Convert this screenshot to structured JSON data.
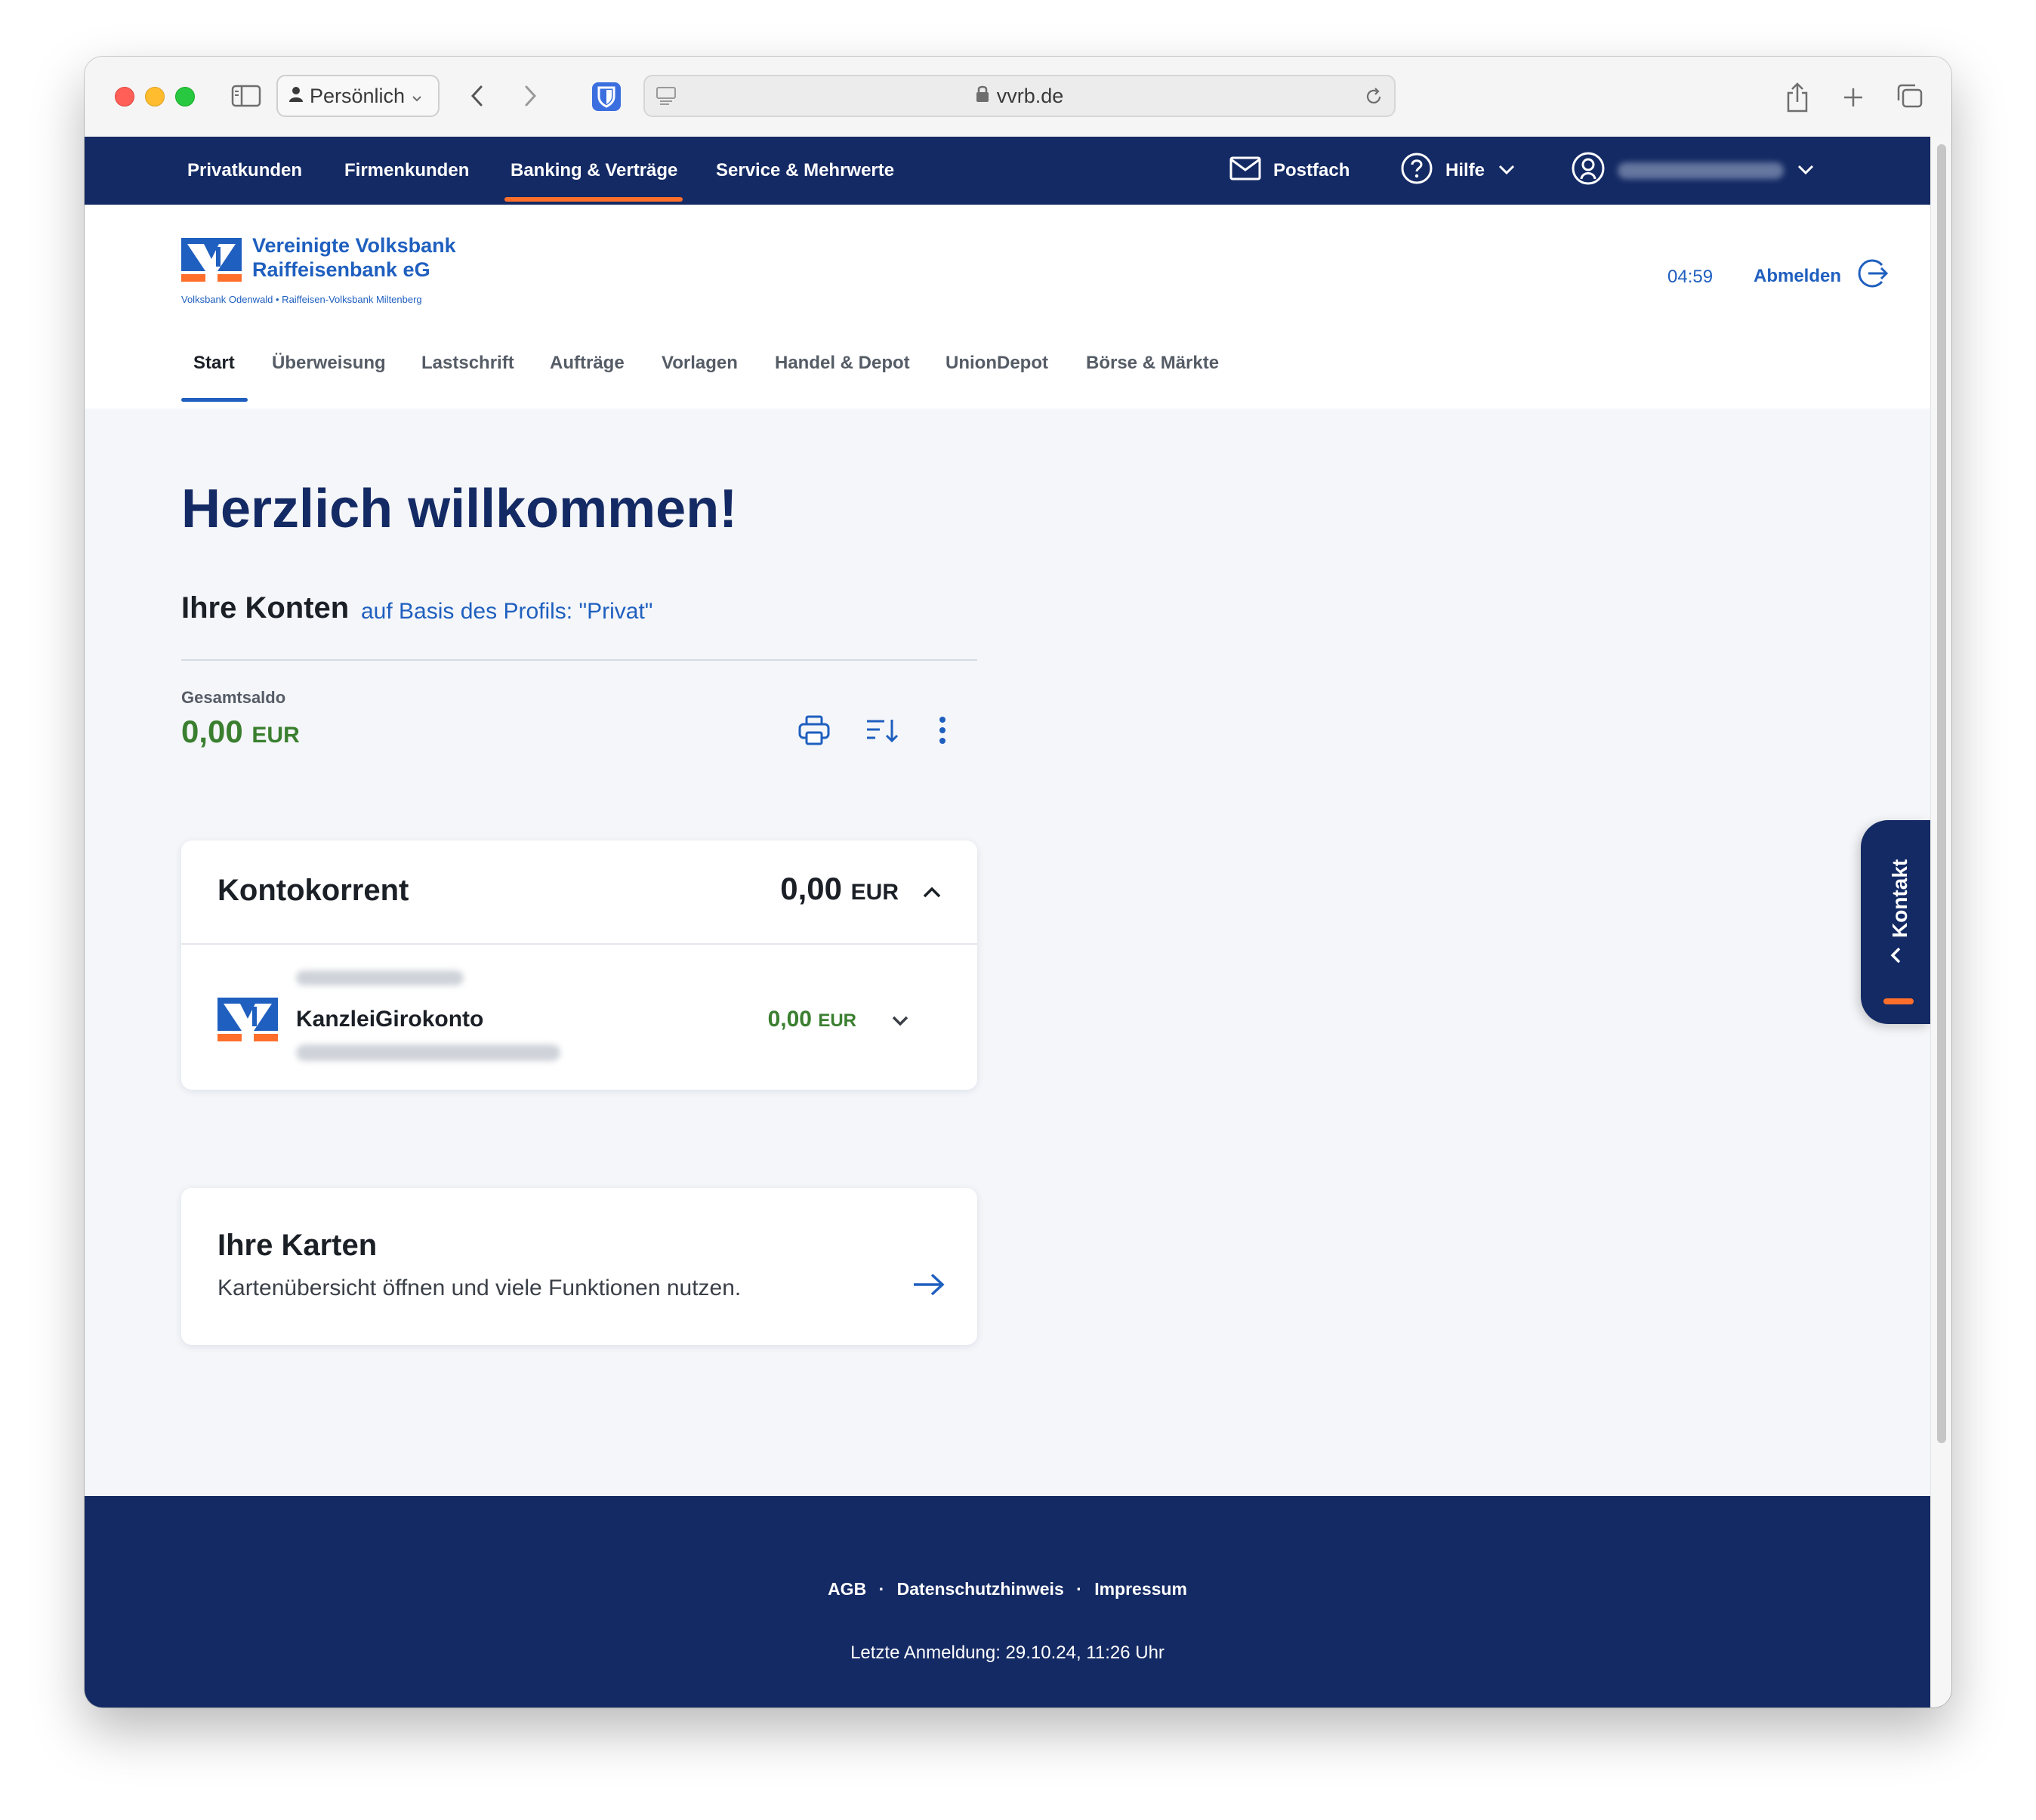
{
  "browser": {
    "profile_label": "Persönlich",
    "url": "vvrb.de"
  },
  "topnav": {
    "items": [
      "Privatkunden",
      "Firmenkunden",
      "Banking & Verträge",
      "Service & Mehrwerte"
    ],
    "active": "Banking & Verträge",
    "postfach": "Postfach",
    "hilfe": "Hilfe"
  },
  "bank": {
    "name_line1": "Vereinigte Volksbank",
    "name_line2": "Raiffeisenbank eG",
    "subtitle": "Volksbank Odenwald • Raiffeisen-Volksbank Miltenberg"
  },
  "session": {
    "timer": "04:59",
    "logout_label": "Abmelden"
  },
  "subnav": {
    "items": [
      "Start",
      "Überweisung",
      "Lastschrift",
      "Aufträge",
      "Vorlagen",
      "Handel & Depot",
      "UnionDepot",
      "Börse & Märkte"
    ],
    "active": "Start"
  },
  "main": {
    "welcome": "Herzlich willkommen!",
    "konten_title": "Ihre Konten",
    "konten_profile": "auf Basis des Profils: \"Privat\"",
    "gesamtsaldo_label": "Gesamtsaldo",
    "gesamtsaldo_amount": "0,00",
    "gesamtsaldo_currency": "EUR"
  },
  "kontokorrent": {
    "title": "Kontokorrent",
    "amount": "0,00",
    "currency": "EUR",
    "account": {
      "name": "KanzleiGirokonto",
      "amount": "0,00",
      "currency": "EUR"
    }
  },
  "karten": {
    "title": "Ihre Karten",
    "description": "Kartenübersicht öffnen und viele Funktionen nutzen."
  },
  "kontakt": {
    "label": "Kontakt"
  },
  "footer": {
    "links": [
      "AGB",
      "Datenschutzhinweis",
      "Impressum"
    ],
    "separator": "·",
    "last_login": "Letzte Anmeldung: 29.10.24, 11:26 Uhr"
  },
  "colors": {
    "navy": "#142a64",
    "brand_blue": "#1f5fbf",
    "accent_orange": "#ff6f2b",
    "positive_green": "#3a7f2f",
    "page_bg": "#f4f6f9"
  }
}
